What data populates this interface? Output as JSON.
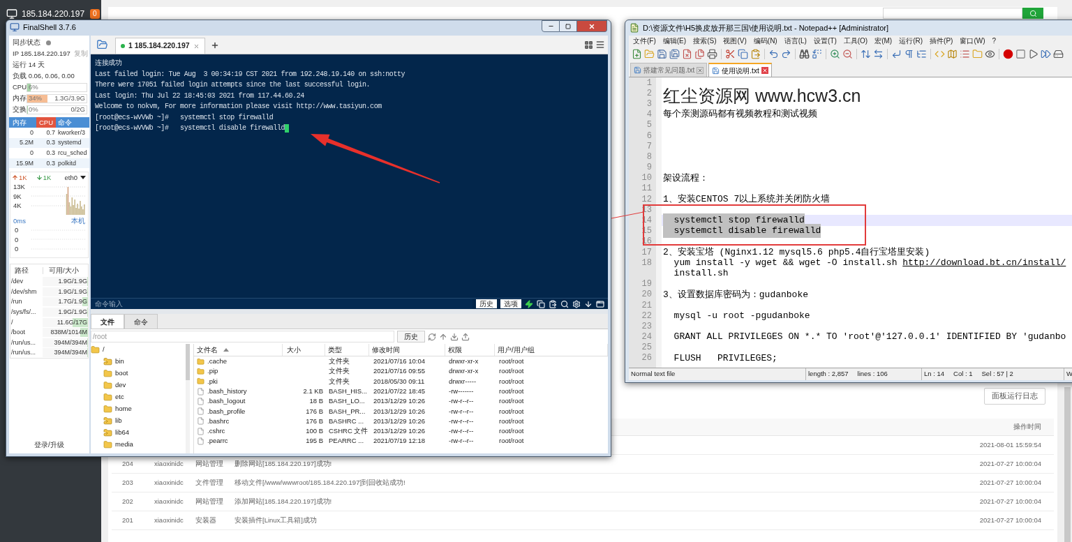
{
  "background_page": {
    "sidebar": {
      "server_ip": "185.184.220.197",
      "badge": "0"
    },
    "log_button": "面板运行日志",
    "log_table": {
      "time_heading": "操作时间",
      "rows": [
        {
          "time": "2021-08-01 15:59:54"
        },
        {
          "id": "204",
          "user": "xiaoxinidc",
          "type": "网站管理",
          "detail": "删除网站[185.184.220.197]成功!",
          "time": "2021-07-27 10:00:04"
        },
        {
          "id": "203",
          "user": "xiaoxinidc",
          "type": "文件管理",
          "detail": "移动文件[/www/wwwroot/185.184.220.197]到回收站成功!",
          "time": "2021-07-27 10:00:04"
        },
        {
          "id": "202",
          "user": "xiaoxinidc",
          "type": "网站管理",
          "detail": "添加网站[185.184.220.197]成功!",
          "time": "2021-07-27 10:00:04"
        },
        {
          "id": "201",
          "user": "xiaoxinidc",
          "type": "安装器",
          "detail": "安装插件[Linux工具箱]成功",
          "time": "2021-07-27 10:00:04"
        }
      ]
    }
  },
  "finalshell": {
    "title": "FinalShell 3.7.6",
    "status": {
      "sync_label": "同步状态",
      "ip": "IP 185.184.220.197",
      "copy_link": "复制",
      "uptime": "运行 14 天",
      "load": "负载 0.06, 0.06, 0.00"
    },
    "meters": [
      {
        "label": "CPU",
        "reading": "6%",
        "level": 0.06,
        "color": "#a9d6a9"
      },
      {
        "label": "内存",
        "reading": "34%",
        "detail": "1.3G/3.9G",
        "level": 0.34,
        "color": "#f6bd94"
      },
      {
        "label": "交换",
        "reading": "0%",
        "detail": "0/2G",
        "level": 0,
        "color": "#a9d6a9"
      }
    ],
    "processes": {
      "columns": [
        {
          "label": "内存",
          "sorted": false
        },
        {
          "label": "CPU",
          "sorted": true
        },
        {
          "label": "命令",
          "sorted": false
        }
      ],
      "rows": [
        {
          "memory": "0",
          "cpu": "0.7",
          "command": "kworker/3"
        },
        {
          "memory": "5.2M",
          "cpu": "0.3",
          "command": "systemd"
        },
        {
          "memory": "0",
          "cpu": "0.3",
          "command": "rcu_sched"
        },
        {
          "memory": "15.9M",
          "cpu": "0.3",
          "command": "polkitd"
        }
      ]
    },
    "network": {
      "upload": "1K",
      "download": "1K",
      "interface": "eth0",
      "y_labels": [
        "13K",
        "9K",
        "4K"
      ]
    },
    "latency": {
      "reading": "0ms",
      "host": "本机",
      "y_labels": [
        "0",
        "0",
        "0"
      ]
    },
    "disks": {
      "columns": [
        "路径",
        "可用/大小"
      ],
      "rows": [
        {
          "path": "/dev",
          "usage": "1.9G/1.9G",
          "level": 0
        },
        {
          "path": "/dev/shm",
          "usage": "1.9G/1.9G",
          "level": 0
        },
        {
          "path": "/run",
          "usage": "1.7G/1.9G",
          "level": 0.12
        },
        {
          "path": "/sys/fs/...",
          "usage": "1.9G/1.9G",
          "level": 0
        },
        {
          "path": "/",
          "usage": "11.6G/17G",
          "level": 0.34
        },
        {
          "path": "/boot",
          "usage": "838M/1014M",
          "level": 0.17
        },
        {
          "path": "/run/us...",
          "usage": "394M/394M",
          "level": 0
        },
        {
          "path": "/run/us...",
          "usage": "394M/394M",
          "level": 0
        }
      ]
    },
    "footer": "登录/升级",
    "session_tabs": [
      {
        "label": "1 185.184.220.197",
        "selected": true,
        "connected": true
      }
    ],
    "terminal": {
      "lines": [
        "连接成功",
        "Last failed login: Tue Aug  3 00:34:19 CST 2021 from 192.248.19.140 on ssh:notty",
        "There were 17051 failed login attempts since the last successful login.",
        "Last login: Thu Jul 22 18:45:03 2021 from 117.44.60.24",
        "Welcome to nokvm, For more information please visit http://www.tasiyun.com",
        "[root@ecs-wVVWb ~]#   systemctl stop firewalld",
        "[root@ecs-wVVWb ~]#   systemctl disable firewalld"
      ],
      "cursor": true
    },
    "command_bar": {
      "placeholder": "命令输入",
      "buttons": [
        "历史",
        "选项"
      ]
    },
    "file_panel": {
      "tabs": [
        {
          "label": "文件",
          "selected": true
        },
        {
          "label": "命令",
          "selected": false
        }
      ],
      "path": "/root",
      "history_button": "历史",
      "tree": [
        {
          "name": "/",
          "kind": "folder",
          "children": [
            {
              "name": "bin",
              "kind": "link"
            },
            {
              "name": "boot",
              "kind": "folder"
            },
            {
              "name": "dev",
              "kind": "folder"
            },
            {
              "name": "etc",
              "kind": "folder"
            },
            {
              "name": "home",
              "kind": "folder"
            },
            {
              "name": "lib",
              "kind": "link"
            },
            {
              "name": "lib64",
              "kind": "link"
            },
            {
              "name": "media",
              "kind": "folder"
            }
          ]
        }
      ],
      "columns": [
        {
          "label": "文件名",
          "sorted": true
        },
        {
          "label": "大小",
          "sorted": false
        },
        {
          "label": "类型",
          "sorted": false
        },
        {
          "label": "修改时间",
          "sorted": false
        },
        {
          "label": "权限",
          "sorted": false
        },
        {
          "label": "用户/用户组",
          "sorted": false
        }
      ],
      "rows": [
        {
          "name": ".cache",
          "kind": "folder",
          "type": "文件夹",
          "modified": "2021/07/16 10:04",
          "permissions": "drwxr-xr-x",
          "owner": "root/root"
        },
        {
          "name": ".pip",
          "kind": "folder",
          "type": "文件夹",
          "modified": "2021/07/16 09:55",
          "permissions": "drwxr-xr-x",
          "owner": "root/root"
        },
        {
          "name": ".pki",
          "kind": "folder",
          "type": "文件夹",
          "modified": "2018/05/30 09:11",
          "permissions": "drwxr-----",
          "owner": "root/root"
        },
        {
          "name": ".bash_history",
          "kind": "file",
          "size": "2.1 KB",
          "type": "BASH_HIS...",
          "modified": "2021/07/22 18:45",
          "permissions": "-rw-------",
          "owner": "root/root"
        },
        {
          "name": ".bash_logout",
          "kind": "file",
          "size": "18 B",
          "type": "BASH_LO...",
          "modified": "2013/12/29 10:26",
          "permissions": "-rw-r--r--",
          "owner": "root/root"
        },
        {
          "name": ".bash_profile",
          "kind": "file",
          "size": "176 B",
          "type": "BASH_PR...",
          "modified": "2013/12/29 10:26",
          "permissions": "-rw-r--r--",
          "owner": "root/root"
        },
        {
          "name": ".bashrc",
          "kind": "file",
          "size": "176 B",
          "type": "BASHRC ...",
          "modified": "2013/12/29 10:26",
          "permissions": "-rw-r--r--",
          "owner": "root/root"
        },
        {
          "name": ".cshrc",
          "kind": "file",
          "size": "100 B",
          "type": "CSHRC 文件",
          "modified": "2013/12/29 10:26",
          "permissions": "-rw-r--r--",
          "owner": "root/root"
        },
        {
          "name": ".pearrc",
          "kind": "file",
          "size": "195 B",
          "type": "PEARRC ...",
          "modified": "2021/07/19 12:18",
          "permissions": "-rw-r--r--",
          "owner": "root/root"
        }
      ]
    }
  },
  "notepad": {
    "title": "D:\\资源文件\\H5换皮放开那三国\\使用说明.txt - Notepad++ [Administrator]",
    "menu": [
      "文件(F)",
      "编辑(E)",
      "搜索(S)",
      "视图(V)",
      "编码(N)",
      "语言(L)",
      "设置(T)",
      "工具(O)",
      "宏(M)",
      "运行(R)",
      "插件(P)",
      "窗口(W)",
      "?"
    ],
    "tabs": [
      {
        "label": "搭建常见问题.txt",
        "selected": false
      },
      {
        "label": "使用说明.txt",
        "selected": true
      }
    ],
    "lines": [
      {
        "number": "1",
        "kind": "text",
        "selected": false,
        "current": false
      },
      {
        "number": "2",
        "kind": "heading",
        "text": "红尘资源网 www.hcw3.cn",
        "selected": false,
        "current": false
      },
      {
        "number": "3",
        "kind": "text",
        "selected": false,
        "current": false
      },
      {
        "number": "4",
        "kind": "text",
        "text": "每个亲测源码都有视频教程和测试视频",
        "selected": false,
        "current": false
      },
      {
        "number": "5",
        "kind": "text",
        "selected": false,
        "current": false
      },
      {
        "number": "6",
        "kind": "text",
        "selected": false,
        "current": false
      },
      {
        "number": "7",
        "kind": "text",
        "selected": false,
        "current": false
      },
      {
        "number": "8",
        "kind": "text",
        "selected": false,
        "current": false
      },
      {
        "number": "9",
        "kind": "text",
        "selected": false,
        "current": false
      },
      {
        "number": "10",
        "kind": "text",
        "text": "架设流程：",
        "selected": false,
        "current": false
      },
      {
        "number": "11",
        "kind": "text",
        "selected": false,
        "current": false
      },
      {
        "number": "12",
        "kind": "text",
        "text": "1、安装CENTOS 7以上系统并关闭防火墙",
        "selected": false,
        "current": false
      },
      {
        "number": "13",
        "kind": "text",
        "selected": false,
        "current": false
      },
      {
        "number": "14",
        "kind": "text",
        "text": "  systemctl stop firewalld",
        "selected": true,
        "current": true
      },
      {
        "number": "15",
        "kind": "text",
        "text": "  systemctl disable firewalld",
        "selected": true,
        "current": false
      },
      {
        "number": "16",
        "kind": "text",
        "selected": false,
        "current": false
      },
      {
        "number": "17",
        "kind": "text",
        "text": "2、安装宝塔 (Nginx1.12 mysql5.6 php5.4自行宝塔里安装)",
        "selected": false,
        "current": false
      },
      {
        "number": "18",
        "kind": "text",
        "text": "  yum install -y wget && wget -O install.sh ",
        "link": "http://download.bt.cn/install/",
        "continuation": "  install.sh",
        "selected": false,
        "current": false
      },
      {
        "number": "19",
        "kind": "text",
        "selected": false,
        "current": false
      },
      {
        "number": "20",
        "kind": "text",
        "text": "3、设置数据库密码为：gudanboke",
        "selected": false,
        "current": false
      },
      {
        "number": "21",
        "kind": "text",
        "selected": false,
        "current": false
      },
      {
        "number": "22",
        "kind": "text",
        "text": "  mysql -u root -pgudanboke",
        "selected": false,
        "current": false
      },
      {
        "number": "23",
        "kind": "text",
        "selected": false,
        "current": false
      },
      {
        "number": "24",
        "kind": "text",
        "text": "  GRANT ALL PRIVILEGES ON *.* TO 'root'@'127.0.0.1' IDENTIFIED BY 'gudanbo",
        "selected": false,
        "current": false
      },
      {
        "number": "25",
        "kind": "text",
        "selected": false,
        "current": false
      },
      {
        "number": "26",
        "kind": "text",
        "text": "  FLUSH   PRIVILEGES;",
        "selected": false,
        "current": false
      }
    ],
    "status_bar": {
      "sections": [
        [
          "Normal text file"
        ],
        [
          "length : 2,857",
          "lines : 106"
        ],
        [
          "Ln : 14",
          "Col : 1",
          "Sel : 57 | 2"
        ],
        [
          "W"
        ]
      ]
    }
  }
}
